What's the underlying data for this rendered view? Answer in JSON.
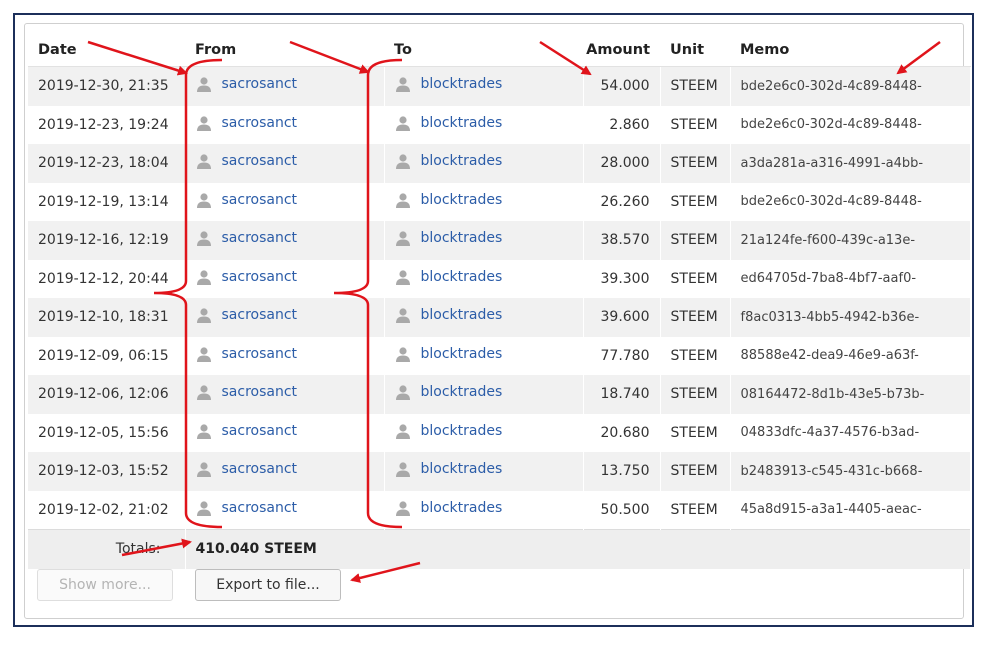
{
  "columns": {
    "date": "Date",
    "from": "From",
    "to": "To",
    "amount": "Amount",
    "unit": "Unit",
    "memo": "Memo"
  },
  "rows": [
    {
      "date": "2019-12-30, 21:35",
      "from": "sacrosanct",
      "to": "blocktrades",
      "amount": "54.000",
      "unit": "STEEM",
      "memo": "bde2e6c0-302d-4c89-8448-"
    },
    {
      "date": "2019-12-23, 19:24",
      "from": "sacrosanct",
      "to": "blocktrades",
      "amount": "2.860",
      "unit": "STEEM",
      "memo": "bde2e6c0-302d-4c89-8448-"
    },
    {
      "date": "2019-12-23, 18:04",
      "from": "sacrosanct",
      "to": "blocktrades",
      "amount": "28.000",
      "unit": "STEEM",
      "memo": "a3da281a-a316-4991-a4bb-"
    },
    {
      "date": "2019-12-19, 13:14",
      "from": "sacrosanct",
      "to": "blocktrades",
      "amount": "26.260",
      "unit": "STEEM",
      "memo": "bde2e6c0-302d-4c89-8448-"
    },
    {
      "date": "2019-12-16, 12:19",
      "from": "sacrosanct",
      "to": "blocktrades",
      "amount": "38.570",
      "unit": "STEEM",
      "memo": "21a124fe-f600-439c-a13e-"
    },
    {
      "date": "2019-12-12, 20:44",
      "from": "sacrosanct",
      "to": "blocktrades",
      "amount": "39.300",
      "unit": "STEEM",
      "memo": "ed64705d-7ba8-4bf7-aaf0-"
    },
    {
      "date": "2019-12-10, 18:31",
      "from": "sacrosanct",
      "to": "blocktrades",
      "amount": "39.600",
      "unit": "STEEM",
      "memo": "f8ac0313-4bb5-4942-b36e-"
    },
    {
      "date": "2019-12-09, 06:15",
      "from": "sacrosanct",
      "to": "blocktrades",
      "amount": "77.780",
      "unit": "STEEM",
      "memo": "88588e42-dea9-46e9-a63f-"
    },
    {
      "date": "2019-12-06, 12:06",
      "from": "sacrosanct",
      "to": "blocktrades",
      "amount": "18.740",
      "unit": "STEEM",
      "memo": "08164472-8d1b-43e5-b73b-"
    },
    {
      "date": "2019-12-05, 15:56",
      "from": "sacrosanct",
      "to": "blocktrades",
      "amount": "20.680",
      "unit": "STEEM",
      "memo": "04833dfc-4a37-4576-b3ad-"
    },
    {
      "date": "2019-12-03, 15:52",
      "from": "sacrosanct",
      "to": "blocktrades",
      "amount": "13.750",
      "unit": "STEEM",
      "memo": "b2483913-c545-431c-b668-"
    },
    {
      "date": "2019-12-02, 21:02",
      "from": "sacrosanct",
      "to": "blocktrades",
      "amount": "50.500",
      "unit": "STEEM",
      "memo": "45a8d915-a3a1-4405-aeac-"
    }
  ],
  "totals": {
    "label": "Totals:",
    "value": "410.040 STEEM"
  },
  "buttons": {
    "show_more": "Show more...",
    "export": "Export to file..."
  },
  "icons": {
    "user": "user-silhouette-icon"
  },
  "colors": {
    "link": "#2c5da8",
    "annotation": "#e0141b",
    "frame": "#1c2f5a"
  }
}
